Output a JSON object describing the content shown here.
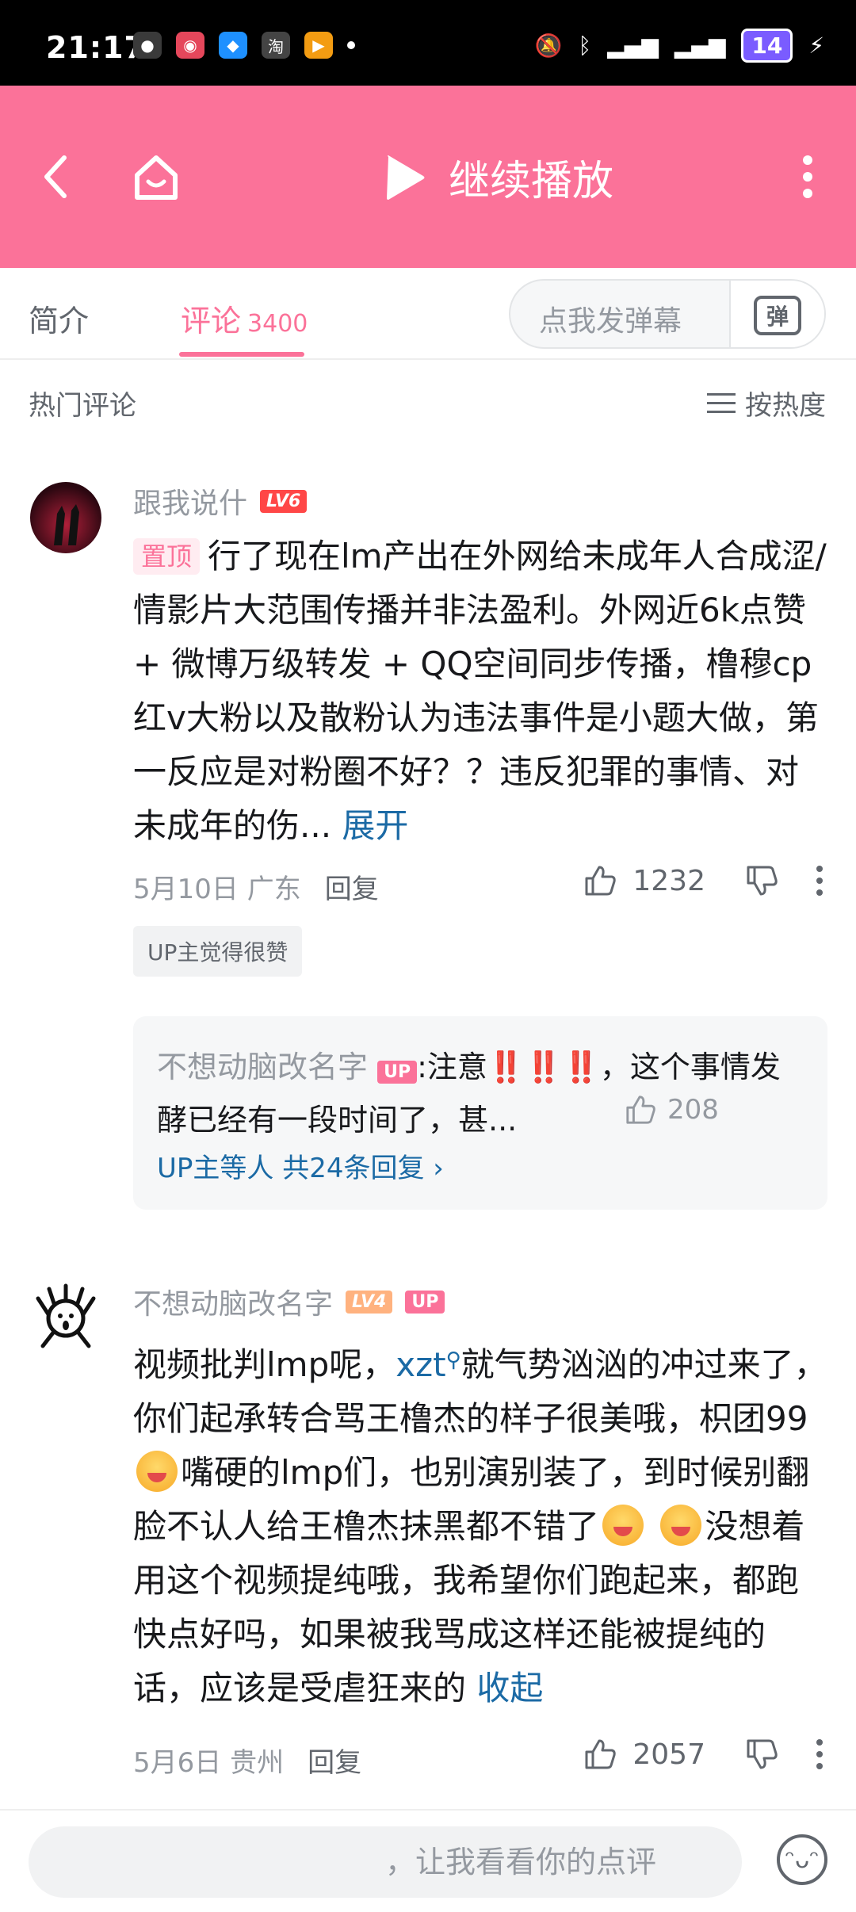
{
  "status_bar": {
    "time": "21:17",
    "battery": "14"
  },
  "top_bar": {
    "continue_label": "继续播放"
  },
  "tabs": {
    "intro_label": "简介",
    "comments_label": "评论",
    "comments_count": "3400",
    "danmu_placeholder": "点我发弹幕",
    "danmu_button_label": "弹"
  },
  "section": {
    "title": "热门评论",
    "sort_label": "按热度"
  },
  "comments": [
    {
      "username": "跟我说什",
      "level": "LV6",
      "pin_label": "置顶",
      "text": "行了现在lm产出在外网给未成年人合成涩/情影片大范围传播并非法盈利。外网近6k点赞 + 微博万级转发 + QQ空间同步传播，橹穆cp红v大粉以及散粉认为违法事件是小题大做，第一反应是对粉圈不好？？违反犯罪的事情、对未成年的伤...",
      "expand_label": "展开",
      "date": "5月10日",
      "location": "广东",
      "reply_label": "回复",
      "likes": "1232",
      "tag": "UP主觉得很赞",
      "sub_reply": {
        "username": "不想动脑改名字",
        "badge": "UP",
        "text": ":注意‼️‼️‼️，这个事情发酵已经有一段时间了，甚...",
        "likes": "208",
        "more_label": "UP主等人 共24条回复"
      }
    },
    {
      "username": "不想动脑改名字",
      "level": "LV4",
      "badge": "UP",
      "text_part1": "视频批判lmp呢，",
      "mention": "xzt",
      "text_part2": "就气势汹汹的冲过来了，你们起承转合骂王橹杰的样子很美哦，枳团99",
      "text_part3": "嘴硬的lmp们，也别演别装了，到时候别翻脸不认人给王橹杰抹黑都不错了",
      "text_part4": "没想着用这个视频提纯哦，我希望你们跑起来，都跑快点好吗，如果被我骂成这样还能被提纯的话，应该是受虐狂来的",
      "collapse_label": "收起",
      "date": "5月6日",
      "location": "贵州",
      "reply_label": "回复",
      "likes": "2057"
    }
  ],
  "bottom_bar": {
    "input_placeholder": "，让我看看你的点评"
  },
  "colors": {
    "brand_pink": "#fb7299",
    "link_blue": "#1b6aa5"
  }
}
